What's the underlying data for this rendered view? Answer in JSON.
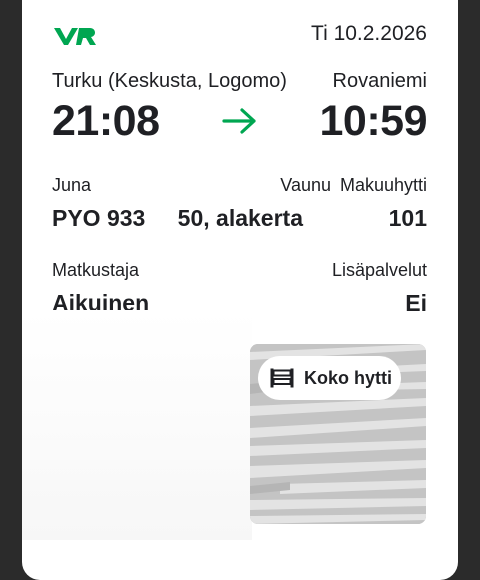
{
  "ticket": {
    "date": "Ti 10.2.2026",
    "from": "Turku (Keskusta, Logomo)",
    "to": "Rovaniemi",
    "departure": "21:08",
    "arrival": "10:59",
    "train_label": "Juna",
    "train_value": "PYO 933",
    "car_label": "Vaunu",
    "car_value": "50, alakerta",
    "cabin_label": "Makuuhytti",
    "cabin_value": "101",
    "passenger_label": "Matkustaja",
    "passenger_value": "Aikuinen",
    "extras_label": "Lisäpalvelut",
    "extras_value": "Ei"
  },
  "cabin_badge": {
    "label": "Koko hytti",
    "icon": "bed-icon"
  },
  "colors": {
    "brand_green": "#00a651",
    "text": "#1f2024",
    "backdrop": "#2b2b2b"
  }
}
